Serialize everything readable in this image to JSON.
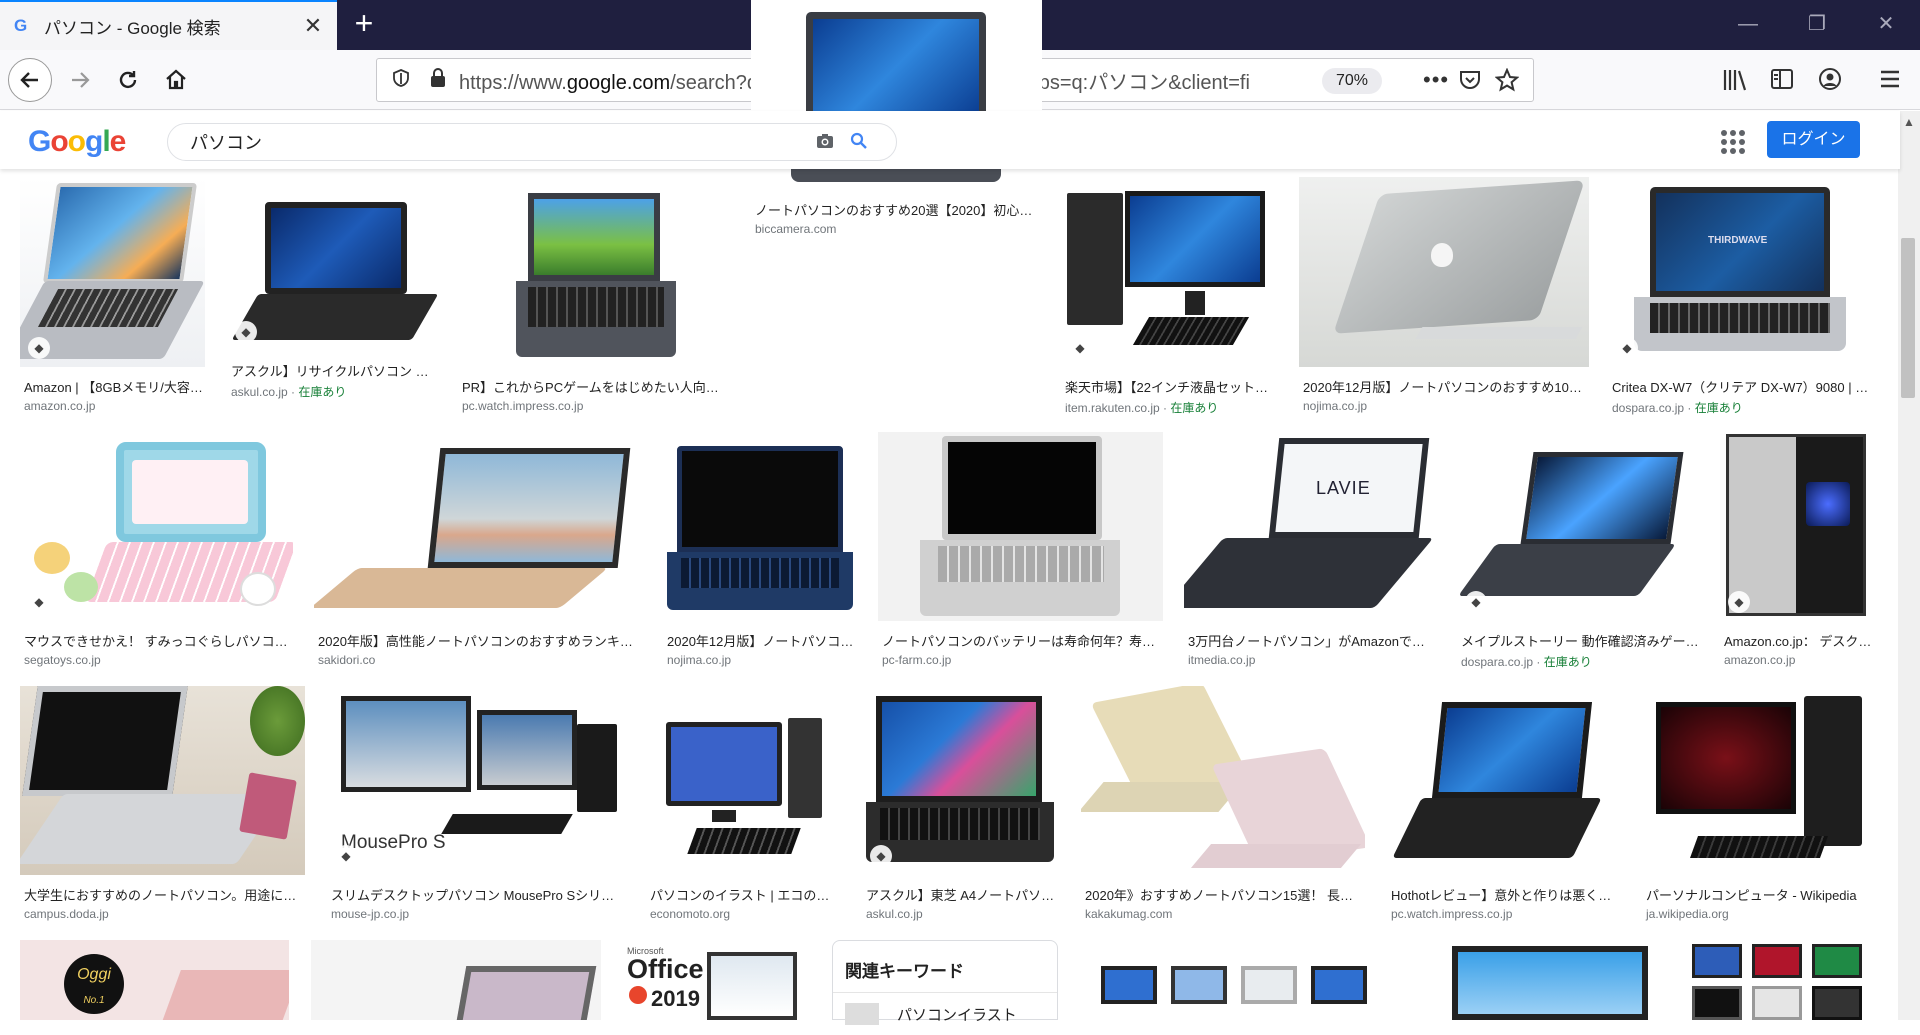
{
  "browser": {
    "tab_title": "パソコン - Google 検索",
    "tab_favicon": "G",
    "new_tab": "+",
    "url_prefix": "https://www.",
    "url_domain": "google.com",
    "url_rest": "/search?q=パソコン&tbm=isch&hl=ja&chips=q:パソコン&client=fi",
    "zoom": "70%"
  },
  "google": {
    "query": "パソコン",
    "login": "ログイン"
  },
  "results": [
    {
      "caption": "Amazon | 【8GBメモリ/大容…",
      "source": "amazon.co.jp",
      "stock": ""
    },
    {
      "caption": "アスクル】リサイクルパソコン …",
      "source": "askul.co.jp · ",
      "stock": "在庫あり"
    },
    {
      "caption": "PR】これからPCゲームをはじめたい人向け…",
      "source": "pc.watch.impress.co.jp",
      "stock": ""
    },
    {
      "caption": "ノートパソコンのおすすめ20選【2020】初心…",
      "source": "biccamera.com",
      "stock": ""
    },
    {
      "caption": "楽天市場】【22インチ液晶セット…",
      "source": "item.rakuten.co.jp · ",
      "stock": "在庫あり"
    },
    {
      "caption": "2020年12月版】ノートパソコンのおすすめ10…",
      "source": "nojima.co.jp",
      "stock": ""
    },
    {
      "caption": "Critea DX-W7（クリテア DX-W7）9080 | …",
      "source": "dospara.co.jp · ",
      "stock": "在庫あり"
    },
    {
      "caption": "マウスできせかえ！ すみっコぐらしパソコ…",
      "source": "segatoys.co.jp",
      "stock": ""
    },
    {
      "caption": "2020年版】高性能ノートパソコンのおすすめランキ…",
      "source": "sakidori.co",
      "stock": ""
    },
    {
      "caption": "2020年12月版】ノートパソコ…",
      "source": "nojima.co.jp",
      "stock": ""
    },
    {
      "caption": "ノートパソコンのバッテリーは寿命何年？寿…",
      "source": "pc-farm.co.jp",
      "stock": ""
    },
    {
      "caption": "3万円台ノートパソコン」がAmazonでタ…",
      "source": "itmedia.co.jp",
      "stock": ""
    },
    {
      "caption": "メイプルストーリー 動作確認済みゲー…",
      "source": "dospara.co.jp · ",
      "stock": "在庫あり"
    },
    {
      "caption": "Amazon.co.jp： デスク…",
      "source": "amazon.co.jp",
      "stock": ""
    },
    {
      "caption": "大学生におすすめのノートパソコン。用途に…",
      "source": "campus.doda.jp",
      "stock": ""
    },
    {
      "caption": "スリムデスクトップパソコン MousePro Sシリー…",
      "source": "mouse-jp.co.jp",
      "stock": ""
    },
    {
      "caption": "パソコンのイラスト | エコのモ…",
      "source": "economoto.org",
      "stock": ""
    },
    {
      "caption": "アスクル】東芝 A4ノートパソ…",
      "source": "askul.co.jp",
      "stock": ""
    },
    {
      "caption": "2020年》おすすめノートパソコン15選！ 長く…",
      "source": "kakakumag.com",
      "stock": ""
    },
    {
      "caption": "Hothotレビュー】意外と作りは悪く…",
      "source": "pc.watch.impress.co.jp",
      "stock": ""
    },
    {
      "caption": "パーソナルコンピュータ - Wikipedia",
      "source": "ja.wikipedia.org",
      "stock": ""
    }
  ],
  "image_text": {
    "thirdwave": "THIRDWAVE",
    "lavie": "LAVIE",
    "mousepro": "MousePro S",
    "office": "Office",
    "office_ms": "Microsoft",
    "office_year": "2019",
    "oggi": "Oggi",
    "oggi_no1": "No.1"
  },
  "related": {
    "title": "関連キーワード",
    "first": "パソコンイラスト"
  }
}
